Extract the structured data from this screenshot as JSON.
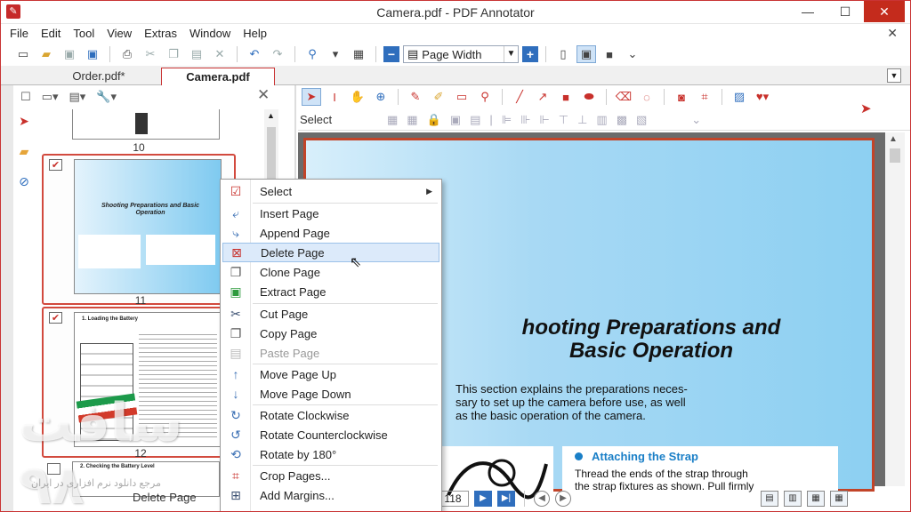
{
  "window": {
    "title": "Camera.pdf - PDF Annotator",
    "app_icon": "pdf-annotator-logo-icon",
    "minimize": "—",
    "maximize": "☐",
    "close": "✕"
  },
  "menu": {
    "items": [
      "File",
      "Edit",
      "Tool",
      "View",
      "Extras",
      "Window",
      "Help"
    ],
    "close_glyph": "✕"
  },
  "toolbar": {
    "zoom_value": "Page Width",
    "zoom_minus": "−",
    "zoom_plus": "+"
  },
  "tabs": {
    "inactive": "Order.pdf*",
    "active": "Camera.pdf"
  },
  "thumbnails": {
    "pages": [
      {
        "number": "10",
        "checked": false
      },
      {
        "number": "11",
        "checked": true,
        "thumb_title": "Shooting Preparations and Basic Operation"
      },
      {
        "number": "12",
        "checked": true,
        "thumb_title": "1. Loading the Battery"
      },
      {
        "number": "",
        "checked": false,
        "thumb_title": "2. Checking the Battery Level"
      }
    ]
  },
  "annotation_toolbar": {
    "select_label": "Select"
  },
  "document": {
    "heading": "hooting Preparations and\nBasic Operation",
    "intro": "This section explains the preparations neces-\nsary to set up the camera before use, as well\nas the basic operation of the camera.",
    "strap_title": "Attaching the Strap",
    "strap_text": "Thread the ends of the strap through\nthe strap fixtures as shown. Pull firmly"
  },
  "navigation": {
    "page_number": "118"
  },
  "status": {
    "text": "Delete Page"
  },
  "context_menu": {
    "items": [
      {
        "label": "Select",
        "icon": "checkmark-icon",
        "submenu": true
      },
      {
        "label": "Insert Page",
        "icon": "insert-page-icon"
      },
      {
        "label": "Append Page",
        "icon": "append-page-icon"
      },
      {
        "label": "Delete Page",
        "icon": "delete-page-icon",
        "highlighted": true
      },
      {
        "label": "Clone Page",
        "icon": "clone-page-icon"
      },
      {
        "label": "Extract Page",
        "icon": "extract-page-icon"
      },
      {
        "label": "Cut Page",
        "icon": "scissors-icon"
      },
      {
        "label": "Copy Page",
        "icon": "copy-icon"
      },
      {
        "label": "Paste Page",
        "icon": "paste-icon",
        "disabled": true
      },
      {
        "label": "Move Page Up",
        "icon": "arrow-up-icon"
      },
      {
        "label": "Move Page Down",
        "icon": "arrow-down-icon"
      },
      {
        "label": "Rotate Clockwise",
        "icon": "rotate-cw-icon"
      },
      {
        "label": "Rotate Counterclockwise",
        "icon": "rotate-ccw-icon"
      },
      {
        "label": "Rotate by 180°",
        "icon": "rotate-180-icon"
      },
      {
        "label": "Crop Pages...",
        "icon": "crop-icon"
      },
      {
        "label": "Add Margins...",
        "icon": "margins-icon"
      }
    ]
  },
  "watermark": {
    "big": "سافت ۹۸",
    "small": "مرجع دانلود نرم افزاری در ایران"
  },
  "colors": {
    "accent_red": "#c93434",
    "highlight_blue": "#dceafa",
    "nav_blue": "#2f6ebd"
  }
}
